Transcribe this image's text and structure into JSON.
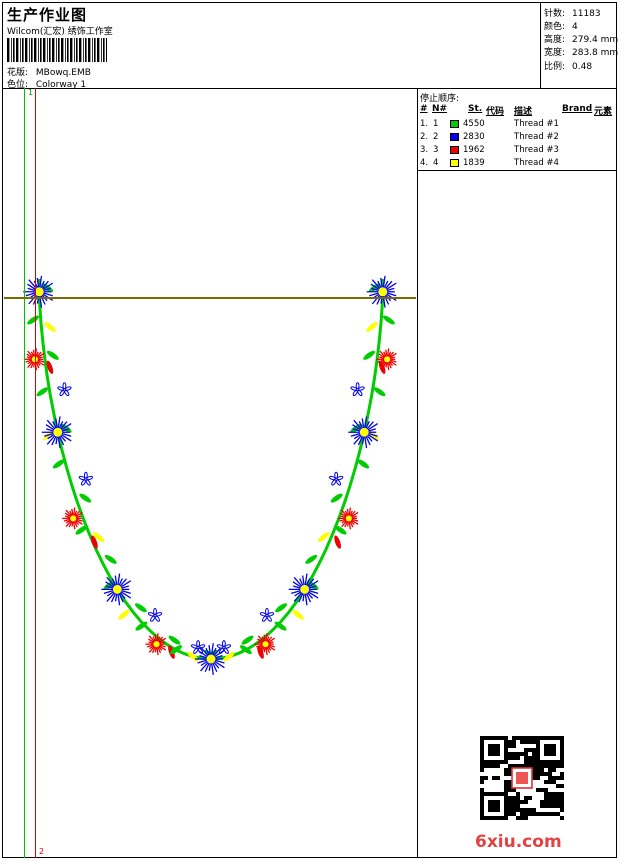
{
  "header": {
    "title": "生产作业图",
    "company": "Wilcom(汇宏) 绣饰工作室",
    "design_label": "花版:",
    "design_value": "MBowq.EMB",
    "colorway_label": "色位:",
    "colorway_value": "Colorway 1"
  },
  "stats": [
    {
      "label": "针数:",
      "value": "11183"
    },
    {
      "label": "颜色:",
      "value": "4"
    },
    {
      "label": "高度:",
      "value": "279.4 mm"
    },
    {
      "label": "宽度:",
      "value": "283.8 mm"
    },
    {
      "label": "比例:",
      "value": "0.48"
    }
  ],
  "legend": {
    "title": "停止顺序:",
    "headers": {
      "num": "#",
      "n": "N#",
      "st": "St.",
      "code": "代码",
      "desc": "描述",
      "brand": "Brand",
      "element": "元素"
    },
    "rows": [
      {
        "num": "1.",
        "n": "1",
        "code": "4550",
        "desc": "Thread #1",
        "color": "#00cc00"
      },
      {
        "num": "2.",
        "n": "2",
        "code": "2830",
        "desc": "Thread #2",
        "color": "#0000ee"
      },
      {
        "num": "3.",
        "n": "3",
        "code": "1962",
        "desc": "Thread #3",
        "color": "#ee0000"
      },
      {
        "num": "4.",
        "n": "4",
        "code": "1839",
        "desc": "Thread #4",
        "color": "#ffff00"
      }
    ]
  },
  "guides": {
    "start": "1",
    "end": "2"
  },
  "watermark": {
    "site": "6xiu.com"
  },
  "colors": {
    "green": "#00cc00",
    "blue": "#0000ee",
    "red": "#ee0000",
    "yellow": "#ffff00"
  }
}
